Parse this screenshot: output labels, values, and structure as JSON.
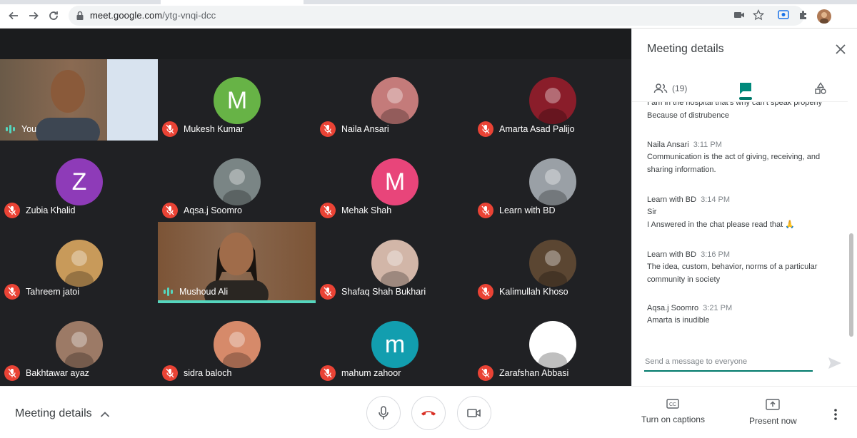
{
  "browser": {
    "url_host": "meet.google.com",
    "url_path": "/ytg-vnqi-dcc"
  },
  "participants": [
    {
      "name": "You",
      "initial": "",
      "bg": "#6a5a48",
      "muted": false,
      "talking": true,
      "video": true
    },
    {
      "name": "Mukesh Kumar",
      "initial": "M",
      "bg": "#67b346",
      "muted": true
    },
    {
      "name": "Naila Ansari",
      "initial": "",
      "bg": "#c47b7a",
      "muted": true
    },
    {
      "name": "Amarta Asad Palijo",
      "initial": "",
      "bg": "#8a1d2a",
      "muted": true
    },
    {
      "name": "Zubia Khalid",
      "initial": "Z",
      "bg": "#8e3bb8",
      "muted": true
    },
    {
      "name": "Aqsa.j Soomro",
      "initial": "",
      "bg": "#7a8585",
      "muted": true
    },
    {
      "name": "Mehak Shah",
      "initial": "M",
      "bg": "#e8457a",
      "muted": true
    },
    {
      "name": "Learn with BD",
      "initial": "",
      "bg": "#9aa0a6",
      "muted": true
    },
    {
      "name": "Tahreem jatoi",
      "initial": "",
      "bg": "#c89a5a",
      "muted": true
    },
    {
      "name": "Mushoud Ali",
      "initial": "",
      "bg": "#7c5436",
      "muted": false,
      "talking": true,
      "video": true
    },
    {
      "name": "Shafaq Shah Bukhari",
      "initial": "",
      "bg": "#d2b6a8",
      "muted": true
    },
    {
      "name": "Kalimullah Khoso",
      "initial": "",
      "bg": "#5b4632",
      "muted": true
    },
    {
      "name": "Bakhtawar ayaz",
      "initial": "",
      "bg": "#9c7a66",
      "muted": true
    },
    {
      "name": "sidra baloch",
      "initial": "",
      "bg": "#d68a6a",
      "muted": true
    },
    {
      "name": "mahum zahoor",
      "initial": "m",
      "bg": "#129eaf",
      "muted": true
    },
    {
      "name": "Zarafshan Abbasi",
      "initial": "",
      "bg": "#ffffff",
      "muted": true
    }
  ],
  "panel": {
    "title": "Meeting details",
    "people_count": "(19)",
    "messages": [
      {
        "sender": "",
        "time": "",
        "lines": [
          "I am in the hospital that's why can't speak properly",
          "Because of distrubence"
        ]
      },
      {
        "sender": "Naila Ansari",
        "time": "3:11 PM",
        "lines": [
          "Communication is the act of giving, receiving, and",
          "sharing information."
        ]
      },
      {
        "sender": "Learn with BD",
        "time": "3:14 PM",
        "lines": [
          "Sir",
          "I Answered in the chat please read that 🙏"
        ]
      },
      {
        "sender": "Learn with BD",
        "time": "3:16 PM",
        "lines": [
          "The idea, custom, behavior, norms of a particular",
          "community in society"
        ]
      },
      {
        "sender": "Aqsa.j Soomro",
        "time": "3:21 PM",
        "lines": [
          "Amarta is inudible"
        ]
      }
    ],
    "input_placeholder": "Send a message to everyone"
  },
  "bottom": {
    "meeting_details": "Meeting details",
    "captions": "Turn on captions",
    "present": "Present now"
  }
}
